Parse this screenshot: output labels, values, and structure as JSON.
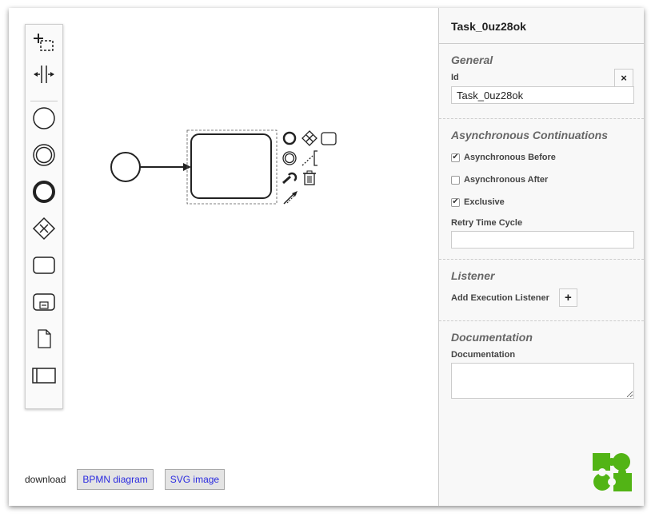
{
  "panel": {
    "header_title": "Task_0uz28ok",
    "general": {
      "title": "General",
      "id_label": "Id",
      "id_value": "Task_0uz28ok",
      "clear_label": "×"
    },
    "async": {
      "title": "Asynchronous Continuations",
      "before_label": "Asynchronous Before",
      "before_checked": true,
      "after_label": "Asynchronous After",
      "after_checked": false,
      "exclusive_label": "Exclusive",
      "exclusive_checked": true,
      "retry_label": "Retry Time Cycle",
      "retry_value": ""
    },
    "listener": {
      "title": "Listener",
      "add_label": "Add Execution Listener",
      "add_button": "+"
    },
    "documentation": {
      "title": "Documentation",
      "field_label": "Documentation",
      "value": ""
    }
  },
  "download": {
    "label": "download",
    "bpmn_button": "BPMN diagram",
    "svg_button": "SVG image"
  },
  "palette": {
    "tools": [
      "lasso-tool-icon",
      "space-tool-icon",
      "start-event-icon",
      "intermediate-event-icon",
      "end-event-icon",
      "gateway-icon",
      "task-icon",
      "subprocess-icon",
      "data-object-icon",
      "participant-icon"
    ]
  },
  "colors": {
    "panel_bg": "#f8f8f8",
    "logo_green": "#52b415",
    "link_blue": "#2a2adf"
  }
}
